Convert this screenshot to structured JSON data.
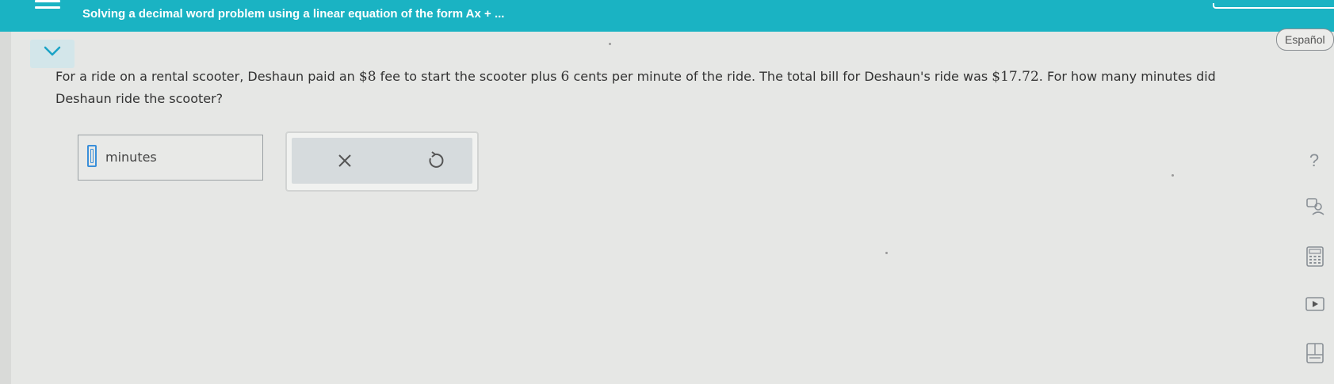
{
  "header": {
    "title": "Solving a decimal word problem using a linear equation of the form Ax + ..."
  },
  "language_button": "Español",
  "question": {
    "part1": "For a ride on a rental scooter, Deshaun paid an ",
    "fee": "$8",
    "part2": " fee to start the scooter plus ",
    "rate": "6",
    "part3": " cents per minute of the ride. The total bill for Deshaun's ride was ",
    "total": "$17.72",
    "part4": ". For how many minutes did Deshaun ride the scooter?"
  },
  "answer": {
    "value": "",
    "unit": "minutes"
  },
  "sidebar_tools": {
    "help": "?",
    "icons": [
      "question-mark-icon",
      "answer-lookup-icon",
      "calculator-icon",
      "video-icon",
      "textbook-icon"
    ]
  },
  "colors": {
    "header_bg": "#1ab3c3",
    "accent_blue": "#3a8fd9",
    "background": "#e6e7e5"
  }
}
